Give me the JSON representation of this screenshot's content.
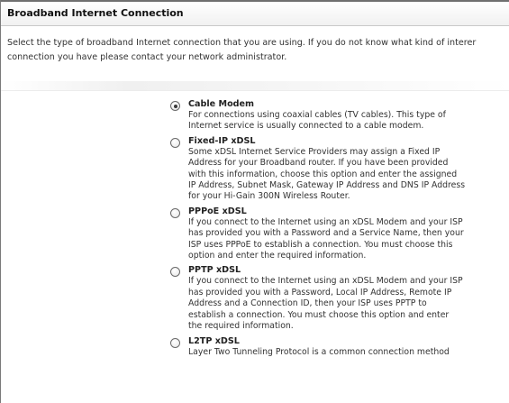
{
  "header": {
    "title": "Broadband Internet Connection"
  },
  "intro": {
    "line1": "Select the type of broadband Internet connection that you are using. If you do not know what kind of interer",
    "line2": "connection you have please contact your network administrator."
  },
  "options": [
    {
      "title": "Cable Modem",
      "selected": true,
      "lines": [
        "For connections using coaxial cables (TV cables). This type of",
        "Internet service is usually connected to a cable modem."
      ]
    },
    {
      "title": "Fixed-IP xDSL",
      "selected": false,
      "lines": [
        "Some xDSL Internet Service Providers may assign a Fixed IP",
        "Address for your Broadband router. If you have been provided",
        "with this information, choose this option and enter the assigned",
        "IP Address, Subnet Mask, Gateway IP Address and DNS IP Address",
        "for your Hi-Gain 300N Wireless Router."
      ]
    },
    {
      "title": "PPPoE xDSL",
      "selected": false,
      "lines": [
        "If you connect to the Internet using an xDSL Modem and your ISP",
        "has provided you with a Password and a Service Name, then your",
        "ISP uses PPPoE to establish a connection. You must choose this",
        "option and enter the required information."
      ]
    },
    {
      "title": "PPTP xDSL",
      "selected": false,
      "lines": [
        "If you connect to the Internet using an xDSL Modem and your ISP",
        "has provided you with a Password, Local IP Address, Remote IP",
        "Address and a Connection ID, then your ISP uses PPTP to",
        "establish a connection. You must choose this option and enter",
        "the required information."
      ]
    },
    {
      "title": "L2TP xDSL",
      "selected": false,
      "lines": [
        "Layer Two Tunneling Protocol is a common connection method"
      ]
    }
  ]
}
